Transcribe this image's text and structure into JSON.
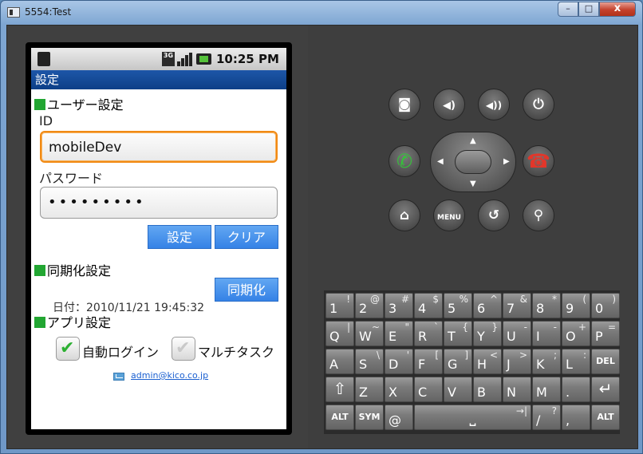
{
  "window": {
    "title": "5554:Test",
    "min_label": "–",
    "max_label": "□",
    "close_label": "x"
  },
  "status_bar": {
    "network": "3G",
    "time": "10:25 PM"
  },
  "app": {
    "title": "設定",
    "user_section": "ユーザー設定",
    "id_label": "ID",
    "id_value": "mobileDev",
    "password_label": "パスワード",
    "password_value": "•••••••••",
    "set_button": "設定",
    "clear_button": "クリア",
    "sync_section": "同期化設定",
    "sync_date": "日付：2010/11/21 19:45:32",
    "sync_button": "同期化",
    "app_section": "アプリ設定",
    "auto_login": {
      "label": "自動ログイン",
      "checked": true
    },
    "multitask": {
      "label": "マルチタスク",
      "checked": false
    },
    "email": "admin@kico.co.jp"
  },
  "controls": {
    "camera": "camera-icon",
    "volume_down": "volume-down-icon",
    "volume_up": "volume-up-icon",
    "power": "power-icon",
    "call": "call-icon",
    "end_call": "end-call-icon",
    "home": "home-icon",
    "menu": "MENU",
    "back": "back-icon",
    "search": "search-icon"
  },
  "keyboard": {
    "row1": [
      {
        "main": "1",
        "alt": "!"
      },
      {
        "main": "2",
        "alt": "@"
      },
      {
        "main": "3",
        "alt": "#"
      },
      {
        "main": "4",
        "alt": "$"
      },
      {
        "main": "5",
        "alt": "%"
      },
      {
        "main": "6",
        "alt": "^"
      },
      {
        "main": "7",
        "alt": "&"
      },
      {
        "main": "8",
        "alt": "*"
      },
      {
        "main": "9",
        "alt": "("
      },
      {
        "main": "0",
        "alt": ")"
      }
    ],
    "row2": [
      {
        "main": "Q",
        "alt": "|"
      },
      {
        "main": "W",
        "alt": "~"
      },
      {
        "main": "E",
        "alt": "\""
      },
      {
        "main": "R",
        "alt": "`"
      },
      {
        "main": "T",
        "alt": "{"
      },
      {
        "main": "Y",
        "alt": "}"
      },
      {
        "main": "U",
        "alt": "-"
      },
      {
        "main": "I",
        "alt": "-"
      },
      {
        "main": "O",
        "alt": "+"
      },
      {
        "main": "P",
        "alt": "="
      }
    ],
    "row3": [
      {
        "main": "A",
        "alt": ""
      },
      {
        "main": "S",
        "alt": "\\"
      },
      {
        "main": "D",
        "alt": "'"
      },
      {
        "main": "F",
        "alt": "["
      },
      {
        "main": "G",
        "alt": "]"
      },
      {
        "main": "H",
        "alt": "<"
      },
      {
        "main": "J",
        "alt": ">"
      },
      {
        "main": "K",
        "alt": ";"
      },
      {
        "main": "L",
        "alt": ":"
      },
      {
        "main": "DEL",
        "alt": ""
      }
    ],
    "row4": [
      {
        "main": "⇧",
        "alt": ""
      },
      {
        "main": "Z",
        "alt": ""
      },
      {
        "main": "X",
        "alt": ""
      },
      {
        "main": "C",
        "alt": ""
      },
      {
        "main": "V",
        "alt": ""
      },
      {
        "main": "B",
        "alt": ""
      },
      {
        "main": "N",
        "alt": ""
      },
      {
        "main": "M",
        "alt": ""
      },
      {
        "main": ".",
        "alt": ""
      },
      {
        "main": "↵",
        "alt": ""
      }
    ],
    "row5": {
      "alt_left": "ALT",
      "sym": "SYM",
      "at": "@",
      "space": "⎵",
      "tab": "→|",
      "slash": "/",
      "slash_alt": "?",
      "comma": ",",
      "alt_right": "ALT"
    }
  }
}
